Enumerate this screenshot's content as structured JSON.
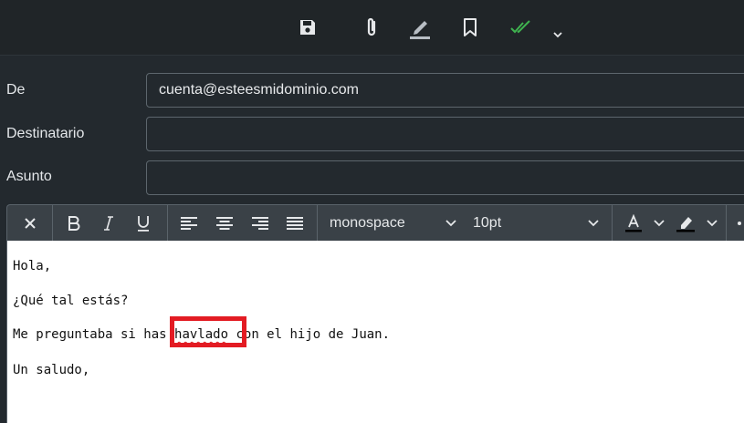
{
  "toolbar": {
    "icons": [
      "save-icon",
      "attach-icon",
      "pen-icon",
      "bookmark-icon",
      "double-check-icon",
      "chevron-down-icon"
    ],
    "accent": "#3fb34f"
  },
  "form": {
    "from_label": "De",
    "from_value": "cuenta@esteesmidominio.com",
    "to_label": "Destinatario",
    "to_value": "",
    "subject_label": "Asunto",
    "subject_value": ""
  },
  "editor_toolbar": {
    "font_family": "monospace",
    "font_size": "10pt"
  },
  "message": {
    "line1": "Hola,",
    "line2": "¿Qué tal estás?",
    "line3_before": "Me preguntaba si has ",
    "line3_misspelled": "havlado",
    "line3_after": " con el hijo de Juan.",
    "line4": "Un saludo,"
  },
  "annotation": {
    "color": "#e31b23"
  }
}
